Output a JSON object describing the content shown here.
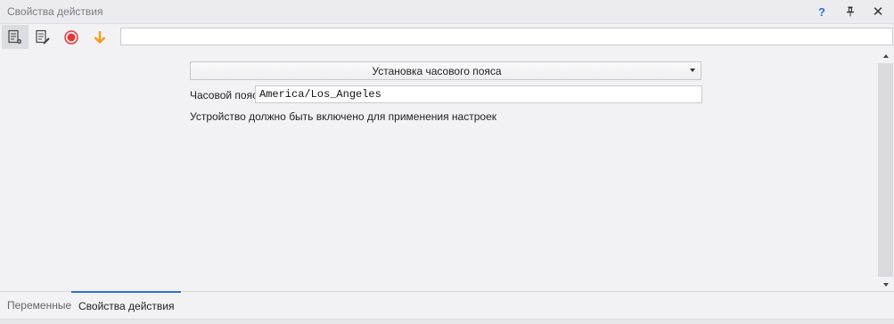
{
  "window": {
    "title": "Свойства действия",
    "help_label": "?",
    "pin_label": "📌",
    "close_label": "✕"
  },
  "toolbar": {
    "search_value": "",
    "icons": [
      "properties-icon",
      "edit-icon",
      "record-icon",
      "download-arrow-icon"
    ],
    "colors": {
      "record": "#e53935",
      "arrow": "#f0a020"
    }
  },
  "content": {
    "dropdown_value": "Установка часового пояса",
    "timezone_label": "Часовой пояс",
    "timezone_value": "America/Los_Angeles",
    "note": "Устройство должно быть включено для применения настроек"
  },
  "tabs": [
    {
      "label": "Переменные",
      "active": false
    },
    {
      "label": "Свойства действия",
      "active": true
    }
  ],
  "colors": {
    "accent": "#2f6fd1",
    "background": "#f2f2f5"
  }
}
